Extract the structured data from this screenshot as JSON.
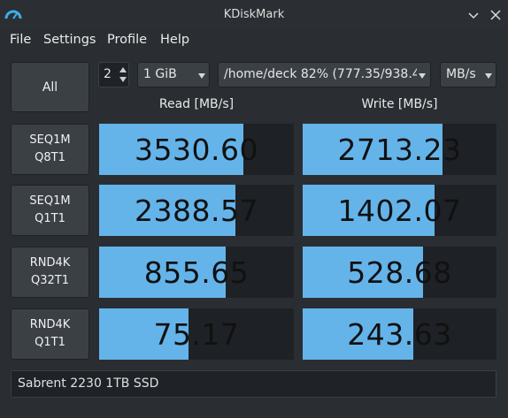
{
  "window": {
    "title": "KDiskMark"
  },
  "menu": [
    "File",
    "Settings",
    "Profile",
    "Help"
  ],
  "controls": {
    "all_label": "All",
    "runs": "2",
    "size": "1 GiB",
    "path": "/home/deck 82% (777.35/938.4",
    "unit": "MB/s"
  },
  "headers": {
    "read": "Read [MB/s]",
    "write": "Write [MB/s]"
  },
  "tests": [
    {
      "line1": "SEQ1M",
      "line2": "Q8T1",
      "read": "3530.60",
      "write": "2713.23",
      "read_fill": 0.74,
      "write_fill": 0.72
    },
    {
      "line1": "SEQ1M",
      "line2": "Q1T1",
      "read": "2388.57",
      "write": "1402.07",
      "read_fill": 0.7,
      "write_fill": 0.68
    },
    {
      "line1": "RND4K",
      "line2": "Q32T1",
      "read": "855.65",
      "write": "528.68",
      "read_fill": 0.65,
      "write_fill": 0.62
    },
    {
      "line1": "RND4K",
      "line2": "Q1T1",
      "read": "75.17",
      "write": "243.63",
      "read_fill": 0.46,
      "write_fill": 0.57
    }
  ],
  "status": "Sabrent 2230 1TB SSD",
  "colors": {
    "bar": "#64b4ea",
    "background": "#2a2e32"
  }
}
